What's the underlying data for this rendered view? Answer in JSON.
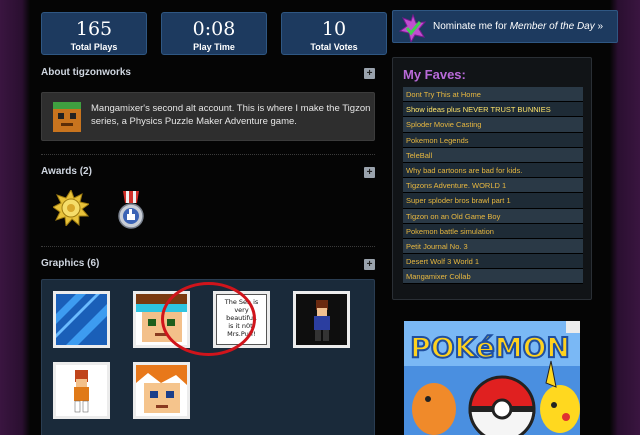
{
  "stats": [
    {
      "value": "165",
      "label": "Total Plays"
    },
    {
      "value": "0:08",
      "label": "Play Time"
    },
    {
      "value": "10",
      "label": "Total Votes"
    }
  ],
  "about": {
    "title": "About tigzonworks",
    "text": "Mangamixer's second alt account. This is where I make the Tigzon series, a Physics Puzzle Maker Adventure game."
  },
  "awards": {
    "title": "Awards (2)"
  },
  "graphics": {
    "title": "Graphics (6)",
    "sea_text": [
      "The Sea is",
      "very",
      "beautiful,",
      "is it n0t,",
      "Mrs.Puff!"
    ]
  },
  "nominate": {
    "prefix": "Nominate me for ",
    "emph": "Member of the Day",
    "suffix": " »"
  },
  "faves": {
    "title": "My Faves:",
    "items": [
      "Dont Try This at Home",
      "Show ideas plus NEVER TRUST BUNNIES",
      "Sploder Movie Casting",
      "Pokemon Legends",
      "TeleBall",
      "Why bad cartoons are bad for kids.",
      "Tigzons Adventure. WORLD 1",
      "Super sploder bros brawl part 1",
      "Tigzon on an Old Game Boy",
      "Pokemon battle simulation",
      "Petit Journal No. 3",
      "Desert Wolf 3 World 1",
      "Mangamixer Collab"
    ]
  },
  "ad": {
    "brand": "POKéMON"
  },
  "icons": {
    "expand": "plus-icon",
    "star": "star-badge-icon",
    "award1": "gold-sun-medal-icon",
    "award2": "thumbs-up-medal-icon"
  },
  "colors": {
    "panel": "#1d3a5f",
    "fave_link": "#e8b840",
    "faves_title": "#b86ad8",
    "highlight": "#d0141b"
  }
}
